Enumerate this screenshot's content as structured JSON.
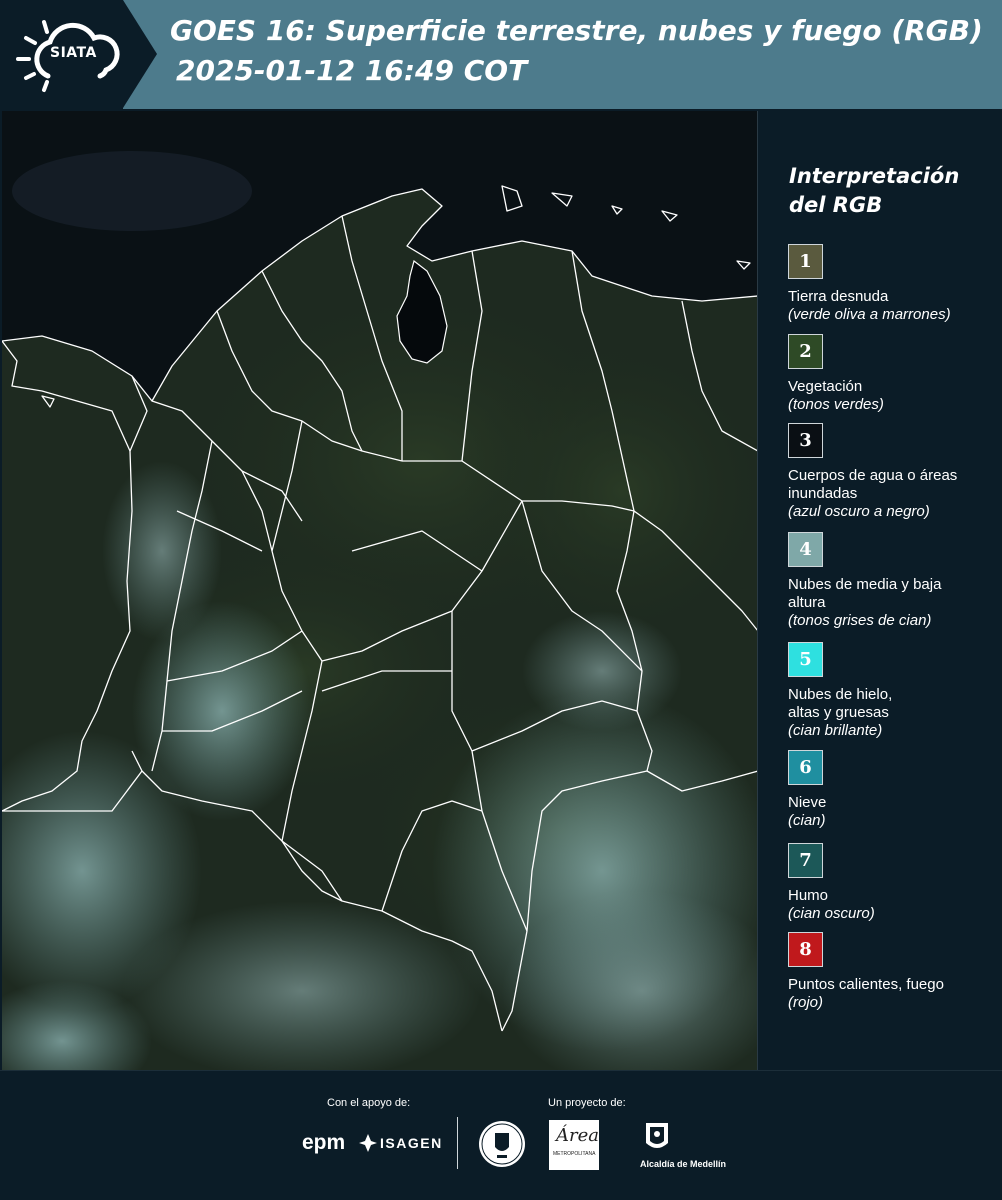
{
  "header": {
    "logo_text": "SIATA",
    "title_line1": "GOES 16: Superficie terrestre, nubes y fuego (RGB)",
    "title_line2": "2025-01-12 16:49 COT"
  },
  "legend": {
    "title_line1": "Interpretación",
    "title_line2": "del RGB",
    "items": [
      {
        "number": "1",
        "label": "Tierra desnuda",
        "sub": "(verde oliva a marrones)",
        "color": "#5a5a3e"
      },
      {
        "number": "2",
        "label": "Vegetación",
        "sub": "(tonos verdes)",
        "color": "#2e4a26"
      },
      {
        "number": "3",
        "label": "Cuerpos de agua o áreas inundadas",
        "sub": "(azul oscuro a negro)",
        "color": "#0a0f14"
      },
      {
        "number": "4",
        "label": "Nubes de media y baja altura",
        "sub": "(tonos grises de cian)",
        "color": "#7fa8a8"
      },
      {
        "number": "5",
        "label": "Nubes de hielo, altas y gruesas",
        "sub": "(cian brillante)",
        "color": "#2ee0e0"
      },
      {
        "number": "6",
        "label": "Nieve",
        "sub": "(cian)",
        "color": "#1f8fa0"
      },
      {
        "number": "7",
        "label": "Humo",
        "sub": "(cian oscuro)",
        "color": "#1c5858"
      },
      {
        "number": "8",
        "label": "Puntos calientes, fuego",
        "sub": "(rojo)",
        "color": "#c0191c"
      }
    ]
  },
  "footer": {
    "support_label": "Con el apoyo de:",
    "project_label": "Un proyecto de:",
    "epm": "epm",
    "isagen": "ISAGEN",
    "amva_script": "Área",
    "amva_text": "METROPOLITANA",
    "medellin": "Alcaldía de Medellín"
  },
  "colors": {
    "header_band": "#4d7b8c",
    "background": "#0b1c27",
    "land": "#1f2b20",
    "ocean": "#0a1014",
    "cloud": "#6f9c9c",
    "boundary": "#ffffff"
  }
}
